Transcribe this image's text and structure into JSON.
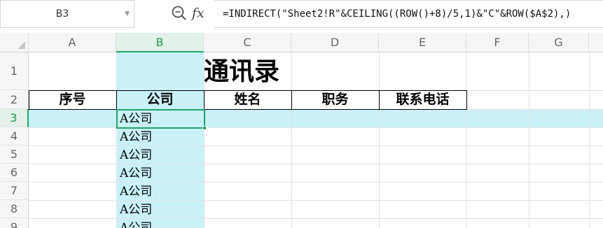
{
  "formula_bar": {
    "name_box": "B3",
    "fx_label": "fx",
    "formula": "=INDIRECT(\"Sheet2!R\"&CEILING((ROW()+8)/5,1)&\"C\"&ROW($A$2),)"
  },
  "columns": [
    "A",
    "B",
    "C",
    "D",
    "E",
    "F",
    "G"
  ],
  "rows": [
    "1",
    "2",
    "3",
    "4",
    "5",
    "6",
    "7",
    "8",
    "9"
  ],
  "sheet": {
    "title": "通讯录",
    "headers": [
      "序号",
      "公司",
      "姓名",
      "职务",
      "联系电话"
    ],
    "company_values": [
      "A公司",
      "A公司",
      "A公司",
      "A公司",
      "A公司",
      "A公司",
      "A公司"
    ]
  },
  "colors": {
    "selection_fill": "#c9f1f8",
    "active_border": "#21a366",
    "header_selected": "#e3f1e8"
  },
  "icons": {
    "zoom": "zoom-formula-icon",
    "dropdown": "chevron-down-icon"
  }
}
